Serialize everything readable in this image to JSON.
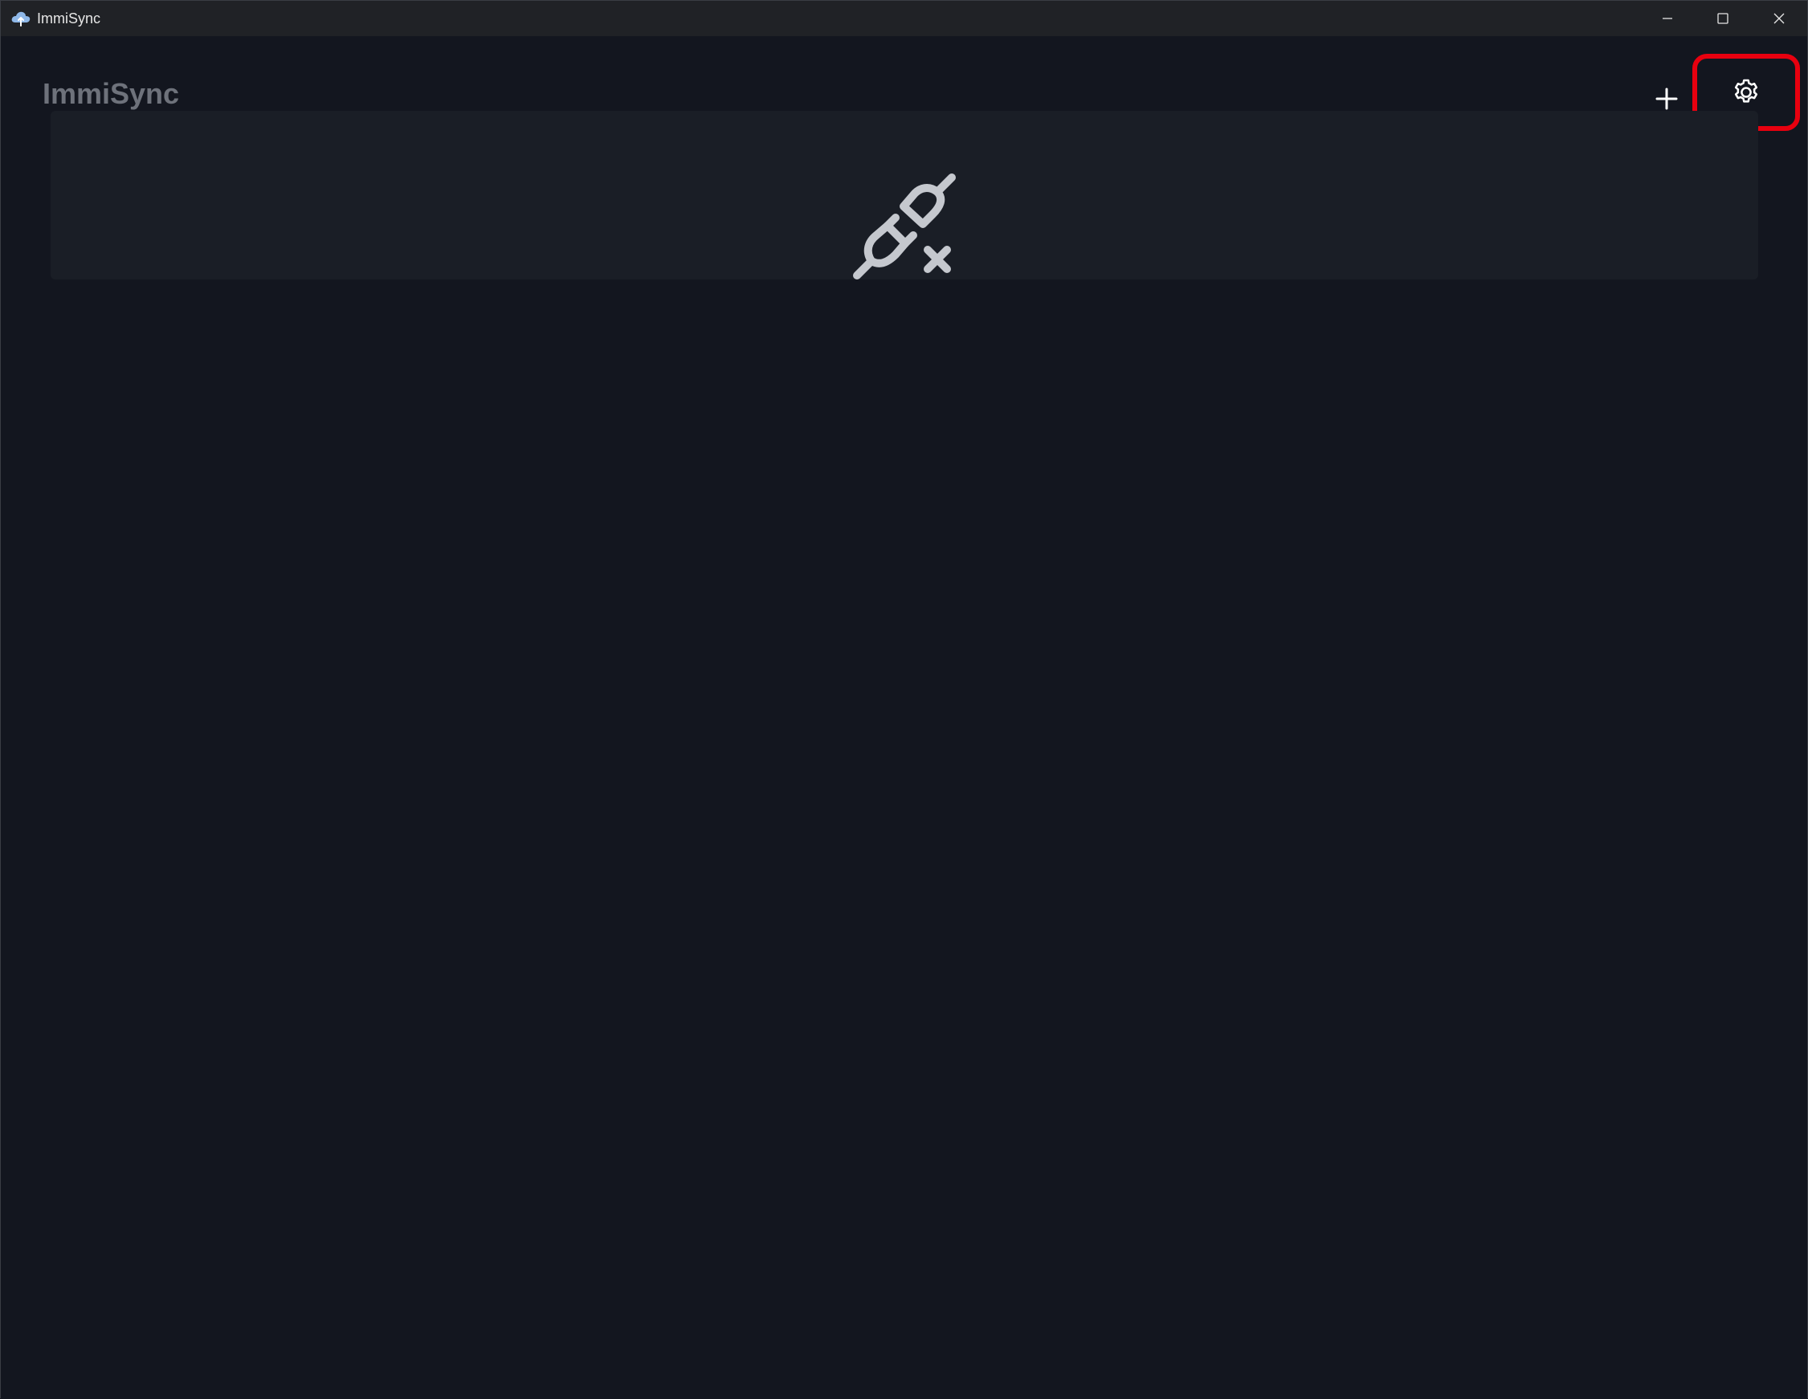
{
  "window": {
    "title": "ImmiSync",
    "controls": [
      "minimize",
      "maximize",
      "close"
    ]
  },
  "header": {
    "app_name": "ImmiSync"
  },
  "toolbar": {
    "add_icon": "plus-icon",
    "settings_icon": "gear-icon",
    "highlight_color": "#e8000f"
  },
  "status": {
    "icon": "plug-disconnected-icon"
  },
  "colors": {
    "background": "#13161f",
    "card": "#1a1e26",
    "title_text": "#6e727b",
    "icon": "#c5c8ce"
  }
}
